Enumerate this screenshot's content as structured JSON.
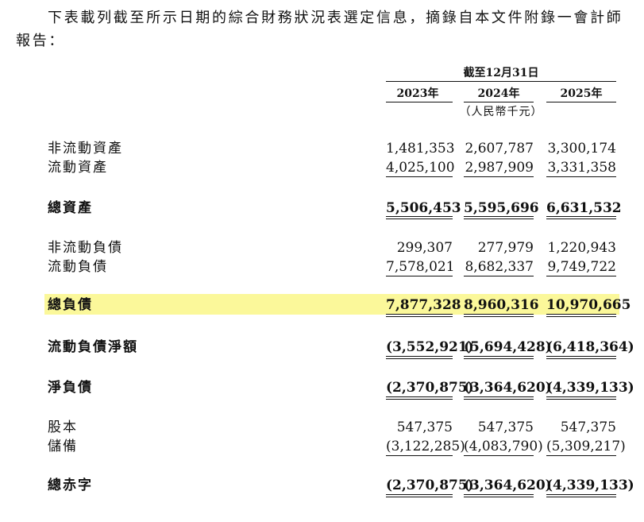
{
  "intro": "下表載列截至所示日期的綜合財務狀況表選定信息，摘錄自本文件附錄一會計師報告：",
  "header": {
    "period": "截至12月31日",
    "years": [
      "2023年",
      "2024年",
      "2025年"
    ],
    "unit": "（人民幣千元）"
  },
  "rows": [
    {
      "label": "非流動資產",
      "values": [
        "1,481,353",
        "2,607,787",
        "3,300,174"
      ]
    },
    {
      "label": "流動資產",
      "values": [
        "4,025,100",
        "2,987,909",
        "3,331,358"
      ]
    },
    {
      "label": "總資產",
      "values": [
        "5,506,453",
        "5,595,696",
        "6,631,532"
      ]
    },
    {
      "label": "非流動負債",
      "values": [
        "299,307",
        "277,979",
        "1,220,943"
      ]
    },
    {
      "label": "流動負債",
      "values": [
        "7,578,021",
        "8,682,337",
        "9,749,722"
      ]
    },
    {
      "label": "總負債",
      "values": [
        "7,877,328",
        "8,960,316",
        "10,970,665"
      ],
      "highlighted": true
    },
    {
      "label": "流動負債淨額",
      "values": [
        "(3,552,921)",
        "(5,694,428)",
        "(6,418,364)"
      ]
    },
    {
      "label": "淨負債",
      "values": [
        "(2,370,875)",
        "(3,364,620)",
        "(4,339,133)"
      ]
    },
    {
      "label": "股本",
      "values": [
        "547,375",
        "547,375",
        "547,375"
      ]
    },
    {
      "label": "儲備",
      "values": [
        "(3,122,285)",
        "(4,083,790)",
        "(5,309,217)"
      ]
    },
    {
      "label": "總赤字",
      "values": [
        "(2,370,875)",
        "(3,364,620)",
        "(4,339,133)"
      ]
    }
  ],
  "highlight_color": "#fbf89a"
}
